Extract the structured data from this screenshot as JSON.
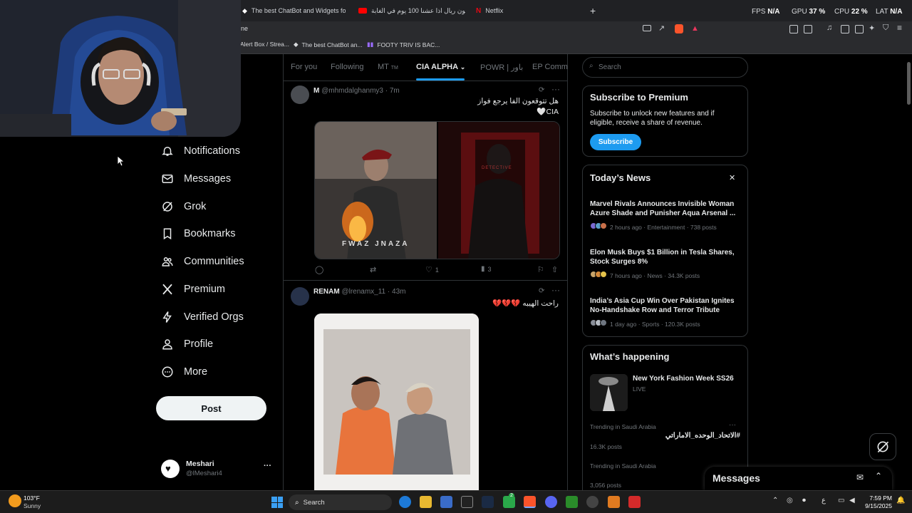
{
  "browser": {
    "tabs": [
      {
        "label": "The best ChatBot and Widgets for Ki",
        "color": "#ffffff"
      },
      {
        "label": "مليون ريال اذا عشنا 100 يوم في الغابة",
        "color": "#ff2a2a"
      },
      {
        "label": "Netflix",
        "color": "#e50914"
      }
    ],
    "new_tab": "+",
    "address_partial": "ne",
    "bookmarks": [
      {
        "label": "Alert Box / Strea..."
      },
      {
        "label": "The best ChatBot an..."
      },
      {
        "label": "FOOTY TRIV IS BAC..."
      }
    ],
    "overlay_stats": {
      "fps_label": "FPS",
      "fps_value": "N/A",
      "gpu_label": "GPU",
      "gpu_value": "37 %",
      "cpu_label": "CPU",
      "cpu_value": "22 %",
      "lat_label": "LAT",
      "lat_value": "N/A"
    }
  },
  "nav": {
    "items": [
      {
        "label": "Notifications",
        "icon": "bell-icon"
      },
      {
        "label": "Messages",
        "icon": "envelope-icon"
      },
      {
        "label": "Grok",
        "icon": "grok-icon"
      },
      {
        "label": "Bookmarks",
        "icon": "bookmark-icon"
      },
      {
        "label": "Communities",
        "icon": "people-icon"
      },
      {
        "label": "Premium",
        "icon": "x-logo-icon"
      },
      {
        "label": "Verified Orgs",
        "icon": "lightning-icon"
      },
      {
        "label": "Profile",
        "icon": "person-icon"
      },
      {
        "label": "More",
        "icon": "more-circle-icon"
      }
    ],
    "post_label": "Post",
    "account": {
      "name": "Meshari",
      "handle": "@lMeshari4",
      "more": "···"
    }
  },
  "feed": {
    "tabs": [
      "For you",
      "Following",
      "MT",
      "CIA ALPHA",
      "POWR | باور",
      "EP Commu"
    ],
    "mt_badge": "TM",
    "posts": [
      {
        "name": "M",
        "handle": "@mhmdalghanmy3",
        "time": "· 7m",
        "text_line1": "هل تتوقعون الفا يرجع فواز",
        "text_line2": "🤍CIA",
        "image_caption": "FWAZ JNAZA",
        "image_sign": "DETECTIVE",
        "likes": "1",
        "views": "3"
      },
      {
        "name": "RENAM",
        "handle": "@lrenamx_11",
        "time": "· 43m",
        "text": "راحت الهيبه 💔💔💔"
      }
    ]
  },
  "right": {
    "search_placeholder": "Search",
    "premium": {
      "title": "Subscribe to Premium",
      "body": "Subscribe to unlock new features and if eligible, receive a share of revenue.",
      "button": "Subscribe"
    },
    "news": {
      "title": "Today’s News",
      "close": "✕",
      "items": [
        {
          "title": "Marvel Rivals Announces Invisible Woman Azure Shade and Punisher Aqua Arsenal ...",
          "meta": "2 hours ago · Entertainment · 738 posts"
        },
        {
          "title": "Elon Musk Buys $1 Billion in Tesla Shares, Stock Surges 8%",
          "meta": "7 hours ago · News · 34.3K posts"
        },
        {
          "title": "India’s Asia Cup Win Over Pakistan Ignites No-Handshake Row and Terror Tribute",
          "meta": "1 day ago · Sports · 120.3K posts"
        }
      ]
    },
    "happening": {
      "title": "What’s happening",
      "event_title": "New York Fashion Week SS26",
      "event_status": "LIVE",
      "trends": [
        {
          "context": "Trending in Saudi Arabia",
          "tag": "#الاتحاد_الوحده_الاماراتي",
          "posts": "16.3K posts"
        },
        {
          "context": "Trending in Saudi Arabia",
          "tag": "",
          "posts": "3,056 posts"
        }
      ]
    },
    "messages_label": "Messages"
  },
  "taskbar": {
    "weather_temp": "103°F",
    "weather_desc": "Sunny",
    "search_label": "Search",
    "lang": "ع",
    "time": "7:59 PM",
    "date": "9/15/2025",
    "badge_count": "2"
  }
}
